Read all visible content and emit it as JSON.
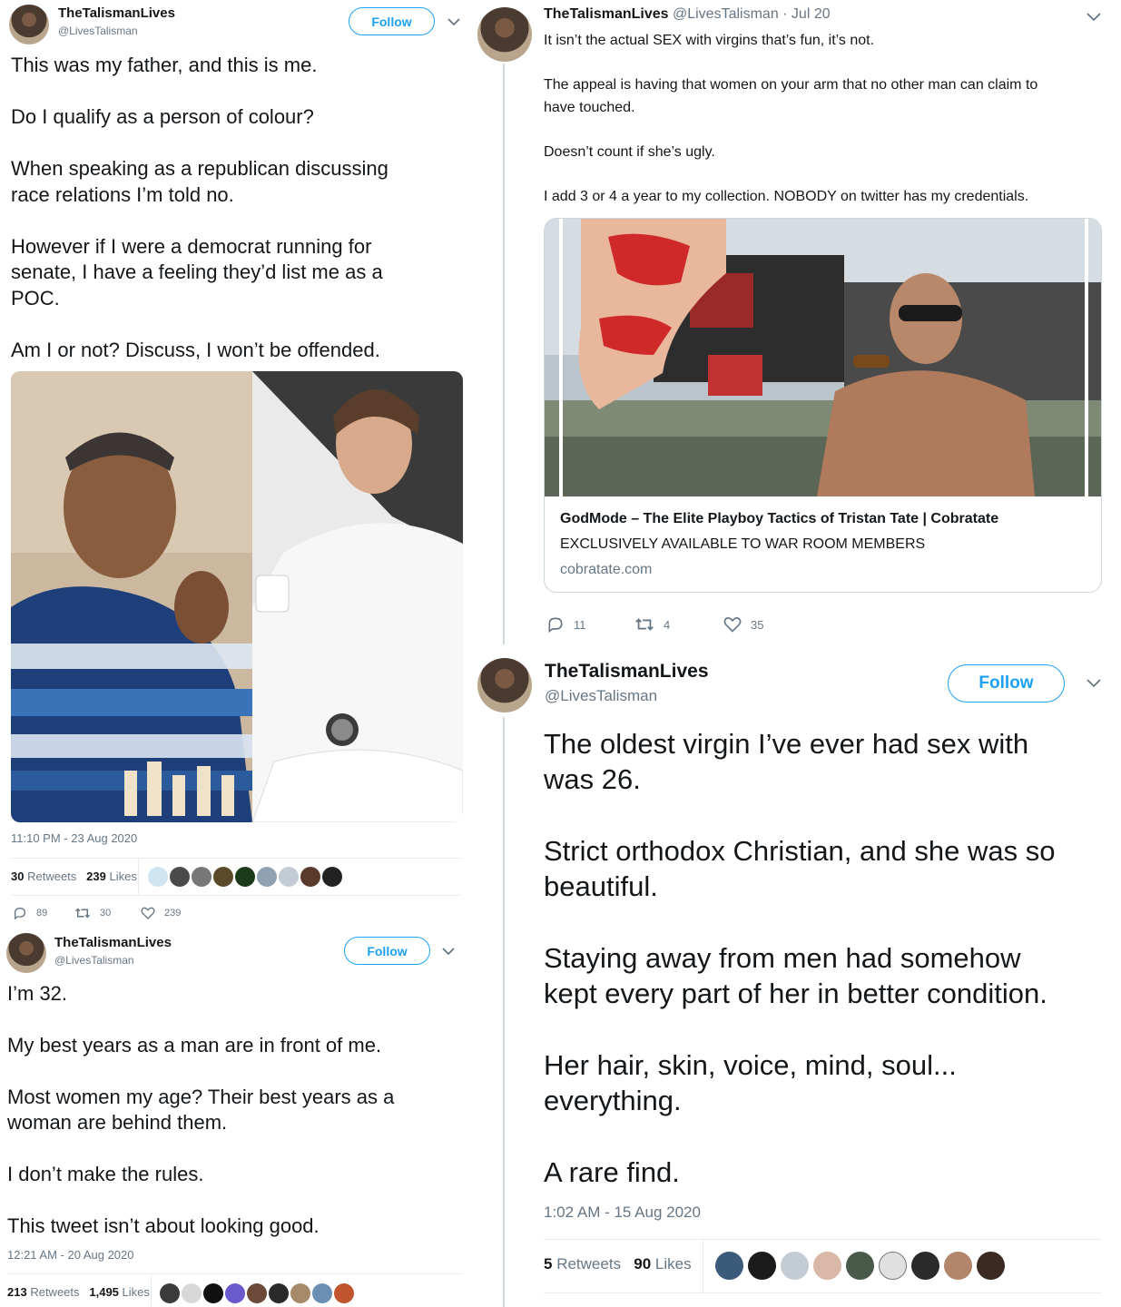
{
  "tweet1": {
    "name": "TheTalismanLives",
    "handle": "@LivesTalisman",
    "follow_label": "Follow",
    "text": "This was my father, and this is me.\n\nDo I qualify as a person of colour?\n\nWhen speaking as a republican discussing\nrace relations I’m told no.\n\nHowever if I were a democrat running for\nsenate, I have a feeling they’d list me as a\nPOC.\n\nAm I or not? Discuss, I won’t be offended.",
    "timestamp": "11:10 PM - 23 Aug 2020",
    "retweets_count": "30",
    "retweets_label": "Retweets",
    "likes_count": "239",
    "likes_label": "Likes",
    "reply_count": "89",
    "retweet_action_count": "30",
    "like_action_count": "239"
  },
  "tweet2": {
    "name": "TheTalismanLives",
    "handle": "@LivesTalisman",
    "follow_label": "Follow",
    "text": "I’m 32.\n\nMy best years as a man are in front of me.\n\nMost women my age? Their best years as a\nwoman are behind them.\n\nI don’t make the rules.\n\nThis tweet isn’t about looking good.",
    "timestamp": "12:21 AM - 20 Aug 2020",
    "retweets_count": "213",
    "retweets_label": "Retweets",
    "likes_count": "1,495",
    "likes_label": "Likes"
  },
  "tweet3": {
    "name": "TheTalismanLives",
    "handle_date": "@LivesTalisman · Jul 20",
    "text": "It isn’t the actual SEX with virgins that’s fun, it’s not.\n\nThe appeal is having that women on your arm that no other man can claim to\nhave touched.\n\nDoesn’t count if she’s ugly.\n\nI add 3 or 4 a year to my collection. NOBODY on twitter has my credentials.",
    "card_title": "GodMode – The Elite Playboy Tactics of Tristan Tate | Cobratate",
    "card_desc": "EXCLUSIVELY AVAILABLE TO WAR ROOM MEMBERS",
    "card_domain": "cobratate.com",
    "reply_count": "11",
    "retweet_count": "4",
    "like_count": "35"
  },
  "tweet4": {
    "name": "TheTalismanLives",
    "handle": "@LivesTalisman",
    "follow_label": "Follow",
    "text": "The oldest virgin I’ve ever had sex with\nwas 26.\n\nStrict orthodox Christian, and she was so\nbeautiful.\n\nStaying away from men had somehow\nkept every part of her in better condition.\n\nHer hair, skin, voice, mind, soul...\neverything.\n\nA rare find.",
    "timestamp": "1:02 AM - 15 Aug 2020",
    "retweets_count": "5",
    "retweets_label": "Retweets",
    "likes_count": "90",
    "likes_label": "Likes"
  },
  "colors": {
    "accent": "#1da1f2",
    "secondary_text": "#657786",
    "divider": "#e6ecf0"
  },
  "icons": [
    "reply-icon",
    "retweet-icon",
    "like-icon",
    "chevron-down-icon"
  ]
}
